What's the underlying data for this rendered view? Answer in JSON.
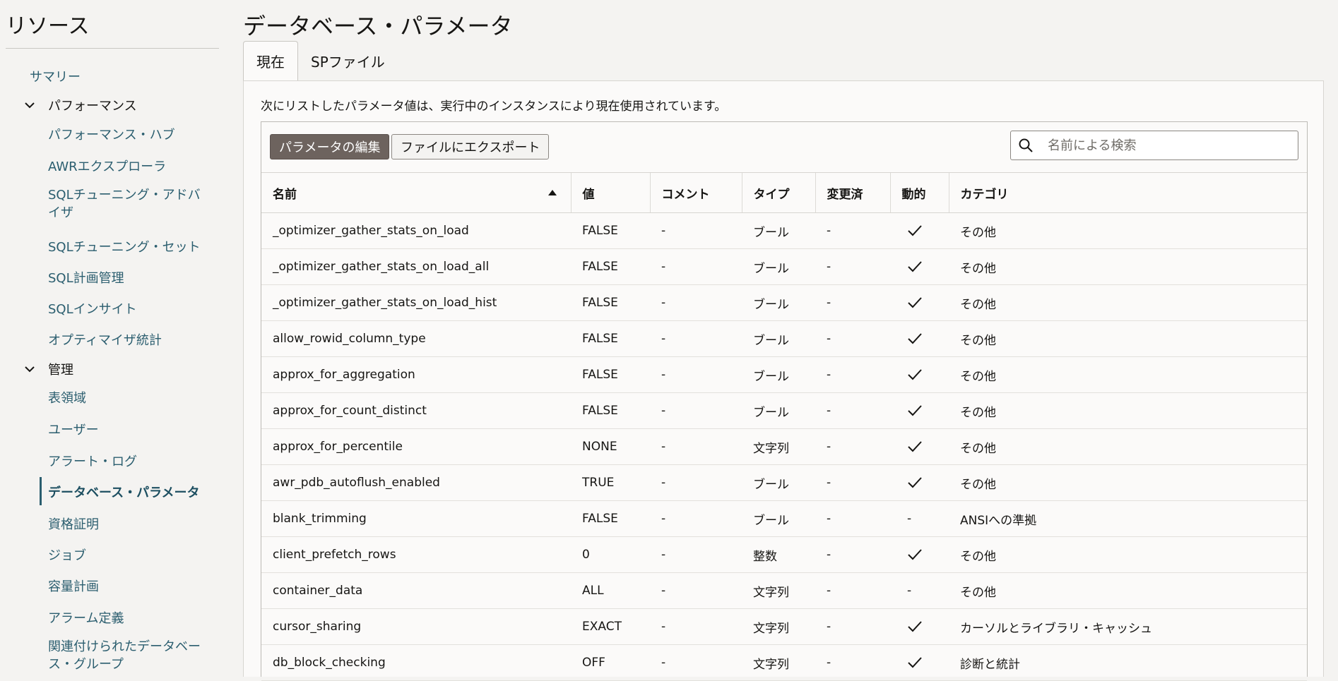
{
  "sidebar": {
    "title": "リソース",
    "items": [
      {
        "label": "サマリー"
      },
      {
        "label": "パフォーマンス"
      },
      {
        "label": "パフォーマンス・ハブ"
      },
      {
        "label": "AWRエクスプローラ"
      },
      {
        "label": "SQLチューニング・アドバイザ"
      },
      {
        "label": "SQLチューニング・セット"
      },
      {
        "label": "SQL計画管理"
      },
      {
        "label": "SQLインサイト"
      },
      {
        "label": "オプティマイザ統計"
      },
      {
        "label": "管理"
      },
      {
        "label": "表領域"
      },
      {
        "label": "ユーザー"
      },
      {
        "label": "アラート・ログ"
      },
      {
        "label": "データベース・パラメータ"
      },
      {
        "label": "資格証明"
      },
      {
        "label": "ジョブ"
      },
      {
        "label": "容量計画"
      },
      {
        "label": "アラーム定義"
      },
      {
        "label": "関連付けられたデータベース・グループ"
      }
    ]
  },
  "page": {
    "title": "データベース・パラメータ",
    "tabs": [
      {
        "label": "現在"
      },
      {
        "label": "SPファイル"
      }
    ],
    "description": "次にリストしたパラメータ値は、実行中のインスタンスにより現在使用されています。"
  },
  "toolbar": {
    "edit_label": "パラメータの編集",
    "export_label": "ファイルにエクスポート",
    "search_placeholder": "名前による検索",
    "search_value": ""
  },
  "table": {
    "columns": [
      "名前",
      "値",
      "コメント",
      "タイプ",
      "変更済",
      "動的",
      "カテゴリ"
    ],
    "sort_column": "名前",
    "sort_direction": "ascending",
    "rows": [
      {
        "name": "_optimizer_gather_stats_on_load",
        "value": "FALSE",
        "comment": "-",
        "type": "ブール",
        "modified": "-",
        "dynamic": true,
        "dynamic_text": "",
        "category": "その他"
      },
      {
        "name": "_optimizer_gather_stats_on_load_all",
        "value": "FALSE",
        "comment": "-",
        "type": "ブール",
        "modified": "-",
        "dynamic": true,
        "dynamic_text": "",
        "category": "その他"
      },
      {
        "name": "_optimizer_gather_stats_on_load_hist",
        "value": "FALSE",
        "comment": "-",
        "type": "ブール",
        "modified": "-",
        "dynamic": true,
        "dynamic_text": "",
        "category": "その他"
      },
      {
        "name": "allow_rowid_column_type",
        "value": "FALSE",
        "comment": "-",
        "type": "ブール",
        "modified": "-",
        "dynamic": true,
        "dynamic_text": "",
        "category": "その他"
      },
      {
        "name": "approx_for_aggregation",
        "value": "FALSE",
        "comment": "-",
        "type": "ブール",
        "modified": "-",
        "dynamic": true,
        "dynamic_text": "",
        "category": "その他"
      },
      {
        "name": "approx_for_count_distinct",
        "value": "FALSE",
        "comment": "-",
        "type": "ブール",
        "modified": "-",
        "dynamic": true,
        "dynamic_text": "",
        "category": "その他"
      },
      {
        "name": "approx_for_percentile",
        "value": "NONE",
        "comment": "-",
        "type": "文字列",
        "modified": "-",
        "dynamic": true,
        "dynamic_text": "",
        "category": "その他"
      },
      {
        "name": "awr_pdb_autoflush_enabled",
        "value": "TRUE",
        "comment": "-",
        "type": "ブール",
        "modified": "-",
        "dynamic": true,
        "dynamic_text": "",
        "category": "その他"
      },
      {
        "name": "blank_trimming",
        "value": "FALSE",
        "comment": "-",
        "type": "ブール",
        "modified": "-",
        "dynamic": false,
        "dynamic_text": "-",
        "category": "ANSIへの準拠"
      },
      {
        "name": "client_prefetch_rows",
        "value": "0",
        "comment": "-",
        "type": "整数",
        "modified": "-",
        "dynamic": true,
        "dynamic_text": "",
        "category": "その他"
      },
      {
        "name": "container_data",
        "value": "ALL",
        "comment": "-",
        "type": "文字列",
        "modified": "-",
        "dynamic": false,
        "dynamic_text": "-",
        "category": "その他"
      },
      {
        "name": "cursor_sharing",
        "value": "EXACT",
        "comment": "-",
        "type": "文字列",
        "modified": "-",
        "dynamic": true,
        "dynamic_text": "",
        "category": "カーソルとライブラリ・キャッシュ"
      },
      {
        "name": "db_block_checking",
        "value": "OFF",
        "comment": "-",
        "type": "文字列",
        "modified": "-",
        "dynamic": true,
        "dynamic_text": "",
        "category": "診断と統計"
      }
    ]
  },
  "colors": {
    "nav_link": "#2b5e6f",
    "primary_button": "#6d635e",
    "background": "#f4f3f1",
    "panel": "#fbfaf9"
  }
}
